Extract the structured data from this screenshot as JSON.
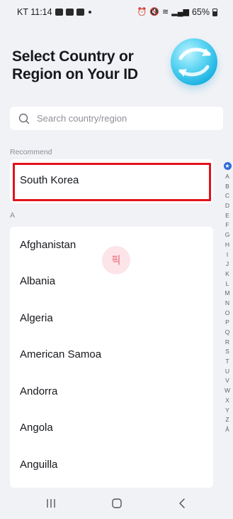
{
  "status_bar": {
    "carrier_time": "KT 11:14",
    "battery": "65%"
  },
  "header": {
    "title": "Select Country or Region on Your ID",
    "icon": "globe-icon"
  },
  "search": {
    "placeholder": "Search country/region",
    "value": ""
  },
  "recommend": {
    "label": "Recommend",
    "items": [
      "South Korea"
    ],
    "highlight_color": "#e3121d"
  },
  "countries": {
    "section": "A",
    "items": [
      "Afghanistan",
      "Albania",
      "Algeria",
      "American Samoa",
      "Andorra",
      "Angola",
      "Anguilla"
    ]
  },
  "watermark": "픽",
  "alphabet_index": {
    "star": "★",
    "letters": [
      "A",
      "B",
      "C",
      "D",
      "E",
      "F",
      "G",
      "H",
      "I",
      "J",
      "K",
      "L",
      "M",
      "N",
      "O",
      "P",
      "Q",
      "R",
      "S",
      "T",
      "U",
      "V",
      "W",
      "X",
      "Y",
      "Z",
      "Å"
    ]
  },
  "colors": {
    "accent": "#2f6bd9",
    "background": "#f1f2f6"
  }
}
